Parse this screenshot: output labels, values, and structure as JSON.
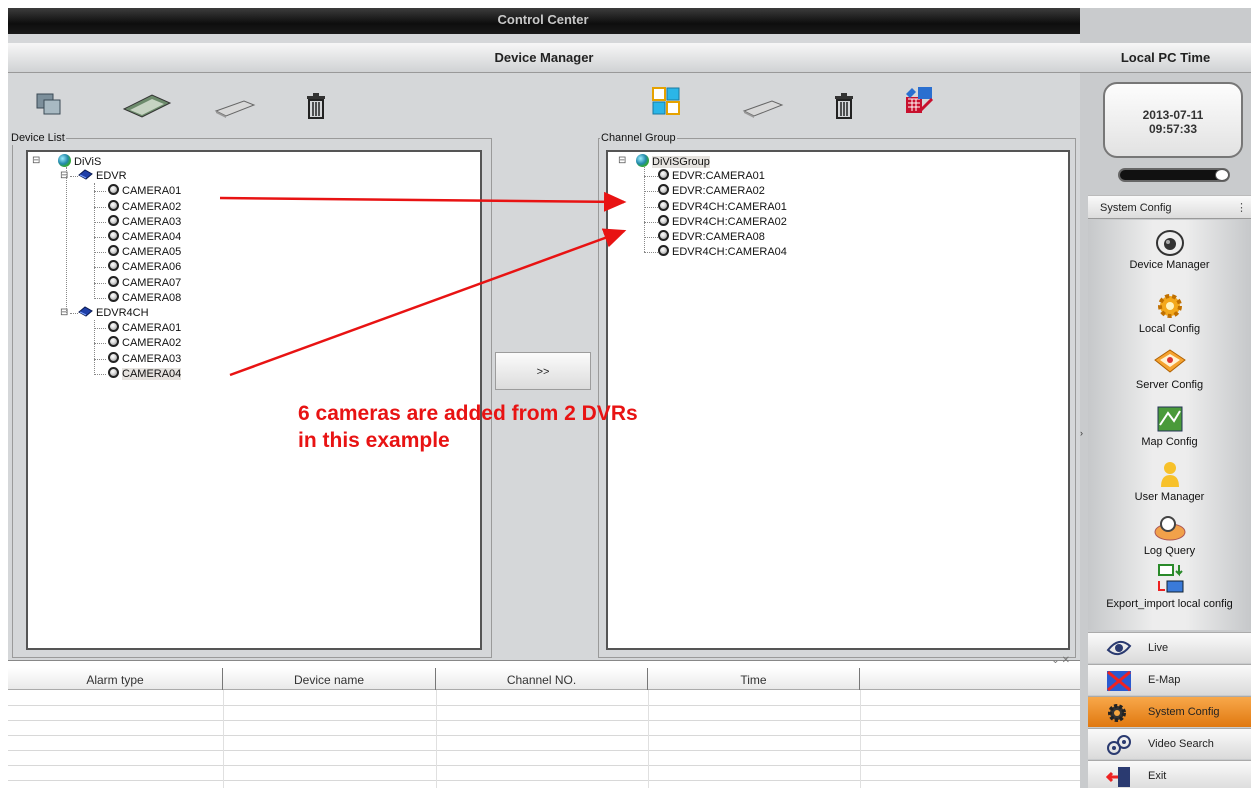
{
  "window": {
    "title": "Control Center"
  },
  "header": {
    "device_manager": "Device Manager",
    "local_time_title": "Local PC Time"
  },
  "clock": {
    "date": "2013-07-11",
    "time": "09:57:33"
  },
  "left_toolbar_icons": [
    "add-device-icon",
    "capture-card-icon",
    "usb-device-icon",
    "delete-icon"
  ],
  "right_toolbar_icons": [
    "channel-grid-icon",
    "usb-device-icon",
    "delete-icon",
    "edit-grid-icon"
  ],
  "device_list": {
    "label": "Device List",
    "root": "DiViS",
    "devices": [
      {
        "name": "EDVR",
        "cameras": [
          "CAMERA01",
          "CAMERA02",
          "CAMERA03",
          "CAMERA04",
          "CAMERA05",
          "CAMERA06",
          "CAMERA07",
          "CAMERA08"
        ]
      },
      {
        "name": "EDVR4CH",
        "cameras": [
          "CAMERA01",
          "CAMERA02",
          "CAMERA03",
          "CAMERA04"
        ]
      }
    ]
  },
  "channel_group": {
    "label": "Channel Group",
    "root": "DiViSGroup",
    "channels": [
      "EDVR:CAMERA01",
      "EDVR:CAMERA02",
      "EDVR4CH:CAMERA01",
      "EDVR4CH:CAMERA02",
      "EDVR:CAMERA08",
      "EDVR4CH:CAMERA04"
    ]
  },
  "move_button": {
    "label": ">>"
  },
  "annotation": {
    "line1": "6 cameras are added from 2 DVRs",
    "line2": "in this example",
    "color": "#e81313"
  },
  "alarm_table": {
    "close_glyphs": "⌄✕",
    "columns": [
      "Alarm type",
      "Device name",
      "Channel NO.",
      "Time",
      ""
    ]
  },
  "system_config": {
    "label": "System Config",
    "items": [
      {
        "label": "Device Manager",
        "icon": "camera-dome-icon"
      },
      {
        "label": "Local Config",
        "icon": "gear-icon"
      },
      {
        "label": "Server Config",
        "icon": "server-icon"
      },
      {
        "label": "Map Config",
        "icon": "map-icon"
      },
      {
        "label": "User Manager",
        "icon": "user-icon"
      },
      {
        "label": "Log Query",
        "icon": "log-icon"
      },
      {
        "label": "Export_import local config",
        "icon": "export-import-icon"
      }
    ]
  },
  "nav": [
    {
      "label": "Live",
      "icon": "eye-icon"
    },
    {
      "label": "E-Map",
      "icon": "emap-icon"
    },
    {
      "label": "System Config",
      "icon": "gear-icon",
      "active": true
    },
    {
      "label": "Video Search",
      "icon": "video-search-icon"
    },
    {
      "label": "Exit",
      "icon": "exit-icon"
    }
  ],
  "colors": {
    "accent": "#f29a2e",
    "titlebar": "#111111",
    "annotation": "#e81313"
  }
}
